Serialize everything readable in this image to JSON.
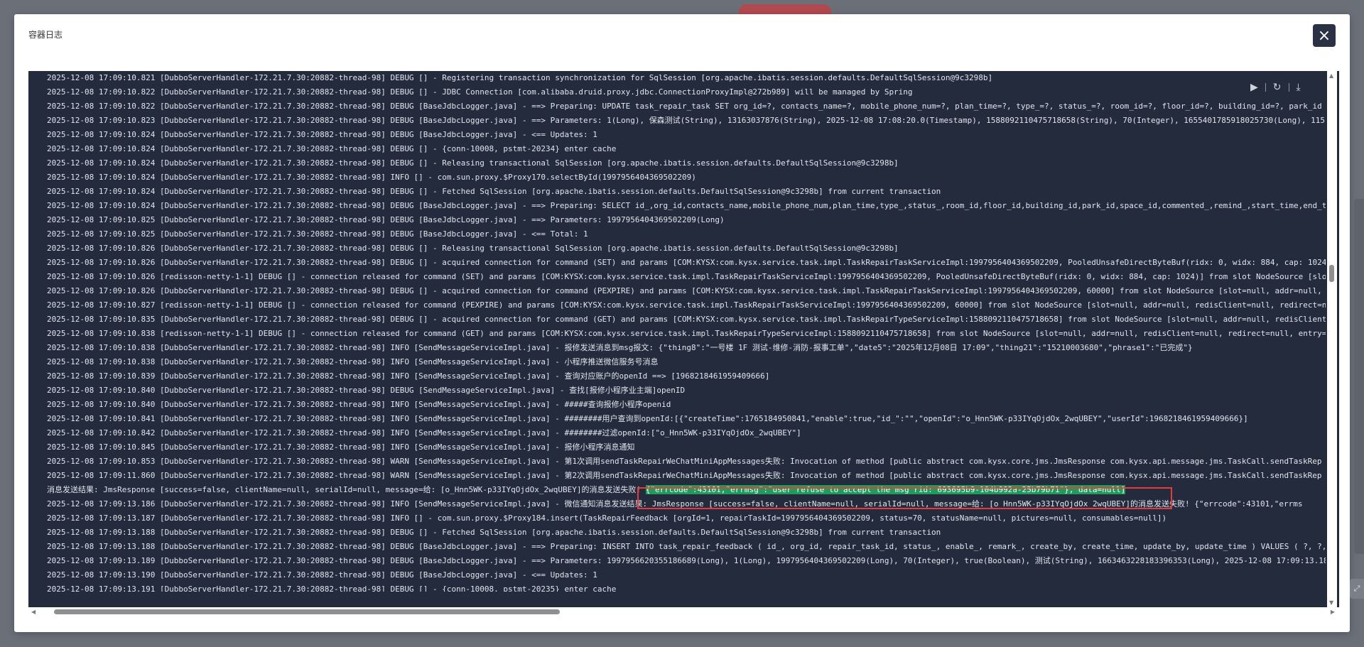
{
  "dialog": {
    "title": "容器日志",
    "close_icon": "×"
  },
  "toolbar": {
    "play_icon": "▶",
    "refresh_icon": "↻",
    "download_icon": "⤓"
  },
  "highlight": {
    "line_index": 29,
    "prefix": "消息发送结果: JmsResponse [success=false, clientName=null, serialId=null, message=给: [o_Hnn5WK-p33IYqOjdOx_2wqUBEY]的消息发送失败! ",
    "text": "{\"errcode\":43101,\"errmsg\":\"user refuse to accept the msg rid: 693695b9-104b992a-25b79b71\"}, data=null]",
    "color": "#1f9b5c",
    "box_color": "#e23c3c"
  },
  "log_lines": [
    "2025-12-08 17:09:10.821 [DubboServerHandler-172.21.7.30:20882-thread-98] DEBUG [] - Registering transaction synchronization for SqlSession [org.apache.ibatis.session.defaults.DefaultSqlSession@9c3298b]",
    "2025-12-08 17:09:10.822 [DubboServerHandler-172.21.7.30:20882-thread-98] DEBUG [] - JDBC Connection [com.alibaba.druid.proxy.jdbc.ConnectionProxyImpl@272b989] will be managed by Spring",
    "2025-12-08 17:09:10.822 [DubboServerHandler-172.21.7.30:20882-thread-98] DEBUG [BaseJdbcLogger.java] - ==>  Preparing: UPDATE task_repair_task SET org_id=?, contacts_name=?, mobile_phone_num=?, plan_time=?, type_=?, status_=?, room_id=?, floor_id=?, building_id=?, park_id",
    "2025-12-08 17:09:10.823 [DubboServerHandler-172.21.7.30:20882-thread-98] DEBUG [BaseJdbcLogger.java] - ==> Parameters: 1(Long), 保森测试(String), 13163037876(String), 2025-12-08 17:08:20.0(Timestamp), 1588092110475718658(String), 70(Integer), 1655401785918025730(Long), 115",
    "2025-12-08 17:09:10.824 [DubboServerHandler-172.21.7.30:20882-thread-98] DEBUG [BaseJdbcLogger.java] - <==    Updates: 1",
    "2025-12-08 17:09:10.824 [DubboServerHandler-172.21.7.30:20882-thread-98] DEBUG [] - {conn-10008, pstmt-20234} enter cache",
    "2025-12-08 17:09:10.824 [DubboServerHandler-172.21.7.30:20882-thread-98] DEBUG [] - Releasing transactional SqlSession [org.apache.ibatis.session.defaults.DefaultSqlSession@9c3298b]",
    "2025-12-08 17:09:10.824 [DubboServerHandler-172.21.7.30:20882-thread-98] INFO [] - com.sun.proxy.$Proxy170.selectById(1997956404369502209)",
    "2025-12-08 17:09:10.824 [DubboServerHandler-172.21.7.30:20882-thread-98] DEBUG [] - Fetched SqlSession [org.apache.ibatis.session.defaults.DefaultSqlSession@9c3298b] from current transaction",
    "2025-12-08 17:09:10.824 [DubboServerHandler-172.21.7.30:20882-thread-98] DEBUG [BaseJdbcLogger.java] - ==>  Preparing: SELECT id_,org_id,contacts_name,mobile_phone_num,plan_time,type_,status_,room_id,floor_id,building_id,park_id,space_id,commented_,remind_,start_time,end_t",
    "2025-12-08 17:09:10.825 [DubboServerHandler-172.21.7.30:20882-thread-98] DEBUG [BaseJdbcLogger.java] - ==> Parameters: 1997956404369502209(Long)",
    "2025-12-08 17:09:10.825 [DubboServerHandler-172.21.7.30:20882-thread-98] DEBUG [BaseJdbcLogger.java] - <==      Total: 1",
    "2025-12-08 17:09:10.826 [DubboServerHandler-172.21.7.30:20882-thread-98] DEBUG [] - Releasing transactional SqlSession [org.apache.ibatis.session.defaults.DefaultSqlSession@9c3298b]",
    "2025-12-08 17:09:10.826 [DubboServerHandler-172.21.7.30:20882-thread-98] DEBUG [] - acquired connection for command (SET) and params [COM:KYSX:com.kysx.service.task.impl.TaskRepairTaskServiceImpl:1997956404369502209, PooledUnsafeDirectByteBuf(ridx: 0, widx: 884, cap: 1024)",
    "2025-12-08 17:09:10.826 [redisson-netty-1-1] DEBUG [] - connection released for command (SET) and params [COM:KYSX:com.kysx.service.task.impl.TaskRepairTaskServiceImpl:1997956404369502209, PooledUnsafeDirectByteBuf(ridx: 0, widx: 884, cap: 1024)] from slot NodeSource [slot",
    "2025-12-08 17:09:10.826 [DubboServerHandler-172.21.7.30:20882-thread-98] DEBUG [] - acquired connection for command (PEXPIRE) and params [COM:KYSX:com.kysx.service.task.impl.TaskRepairTaskServiceImpl:1997956404369502209, 60000] from slot NodeSource [slot=null, addr=null, r",
    "2025-12-08 17:09:10.827 [redisson-netty-1-1] DEBUG [] - connection released for command (PEXPIRE) and params [COM:KYSX:com.kysx.service.task.impl.TaskRepairTaskServiceImpl:1997956404369502209, 60000] from slot NodeSource [slot=null, addr=null, redisClient=null, redirect=null",
    "2025-12-08 17:09:10.835 [DubboServerHandler-172.21.7.30:20882-thread-98] DEBUG [] - acquired connection for command (GET) and params [COM:KYSX:com.kysx.service.task.impl.TaskRepairTypeServiceImpl:1588092110475718658] from slot NodeSource [slot=null, addr=null, redisClient=",
    "2025-12-08 17:09:10.838 [redisson-netty-1-1] DEBUG [] - connection released for command (GET) and params [COM:KYSX:com.kysx.service.task.impl.TaskRepairTypeServiceImpl:1588092110475718658] from slot NodeSource [slot=null, addr=null, redisClient=null, redirect=null, entry=c",
    "2025-12-08 17:09:10.838 [DubboServerHandler-172.21.7.30:20882-thread-98] INFO [SendMessageServiceImpl.java] - 报修发送消息到msg报文: {\"thing8\":\"一号楼 1F 测试-维修-消防-报事工单\",\"date5\":\"2025年12月08日 17:09\",\"thing21\":\"15210003680\",\"phrase1\":\"已完成\"}",
    "2025-12-08 17:09:10.838 [DubboServerHandler-172.21.7.30:20882-thread-98] INFO [SendMessageServiceImpl.java] - 小程序推送微信服务号消息",
    "2025-12-08 17:09:10.839 [DubboServerHandler-172.21.7.30:20882-thread-98] INFO [SendMessageServiceImpl.java] - 查询对应账户的openId ==> [1968218461959409666]",
    "2025-12-08 17:09:10.840 [DubboServerHandler-172.21.7.30:20882-thread-98] DEBUG [SendMessageServiceImpl.java] - 查找[报修小程序业主端]openID",
    "2025-12-08 17:09:10.840 [DubboServerHandler-172.21.7.30:20882-thread-98] INFO [SendMessageServiceImpl.java] - #####查询报修小程序openid",
    "2025-12-08 17:09:10.841 [DubboServerHandler-172.21.7.30:20882-thread-98] INFO [SendMessageServiceImpl.java] - ########用户查询到openId:[{\"createTime\":1765184950841,\"enable\":true,\"id_\":\"\",\"openId\":\"o_Hnn5WK-p33IYqOjdOx_2wqUBEY\",\"userId\":1968218461959409666}]",
    "2025-12-08 17:09:10.842 [DubboServerHandler-172.21.7.30:20882-thread-98] INFO [SendMessageServiceImpl.java] - ########过滤openId:[\"o_Hnn5WK-p33IYqOjdOx_2wqUBEY\"]",
    "2025-12-08 17:09:10.845 [DubboServerHandler-172.21.7.30:20882-thread-98] INFO [SendMessageServiceImpl.java] - 报修小程序消息通知",
    "2025-12-08 17:09:10.853 [DubboServerHandler-172.21.7.30:20882-thread-98] WARN [SendMessageServiceImpl.java] - 第1次调用sendTaskRepairWeChatMiniAppMessages失败: Invocation of method [public abstract com.kysx.core.jms.JmsResponse com.kysx.api.message.jms.TaskCall.sendTaskRep",
    "2025-12-08 17:09:11.860 [DubboServerHandler-172.21.7.30:20882-thread-98] WARN [SendMessageServiceImpl.java] - 第2次调用sendTaskRepairWeChatMiniAppMessages失败: Invocation of method [public abstract com.kysx.core.jms.JmsResponse com.kysx.api.message.jms.TaskCall.sendTaskRep",
    "",
    "2025-12-08 17:09:13.186 [DubboServerHandler-172.21.7.30:20882-thread-98] INFO [SendMessageServiceImpl.java] - 微信通知消息发送结果: JmsResponse [success=false, clientName=null, serialId=null, message=给: [o_Hnn5WK-p33IYqOjdOx_2wqUBEY]的消息发送失败! {\"errcode\":43101,\"errms",
    "2025-12-08 17:09:13.187 [DubboServerHandler-172.21.7.30:20882-thread-98] INFO [] - com.sun.proxy.$Proxy184.insert(TaskRepairFeedback [orgId=1, repairTaskId=1997956404369502209, status=70, statusName=null, pictures=null, consumables=null])",
    "2025-12-08 17:09:13.188 [DubboServerHandler-172.21.7.30:20882-thread-98] DEBUG [] - Fetched SqlSession [org.apache.ibatis.session.defaults.DefaultSqlSession@9c3298b] from current transaction",
    "2025-12-08 17:09:13.188 [DubboServerHandler-172.21.7.30:20882-thread-98] DEBUG [BaseJdbcLogger.java] - ==>  Preparing: INSERT INTO task_repair_feedback ( id_, org_id, repair_task_id, status_, enable_, remark_, create_by, create_time, update_by, update_time ) VALUES ( ?, ?,",
    "2025-12-08 17:09:13.189 [DubboServerHandler-172.21.7.30:20882-thread-98] DEBUG [BaseJdbcLogger.java] - ==> Parameters: 1997956620355186689(Long), 1(Long), 1997956404369502209(Long), 70(Integer), true(Boolean), 测试(String), 1663463228183396353(Long), 2025-12-08 17:09:13.18",
    "2025-12-08 17:09:13.190 [DubboServerHandler-172.21.7.30:20882-thread-98] DEBUG [BaseJdbcLogger.java] - <==    Updates: 1",
    "2025-12-08 17:09:13.191 [DubboServerHandler-172.21.7.30:20882-thread-98] DEBUG [] - {conn-10008, pstmt-20235} enter cache"
  ]
}
